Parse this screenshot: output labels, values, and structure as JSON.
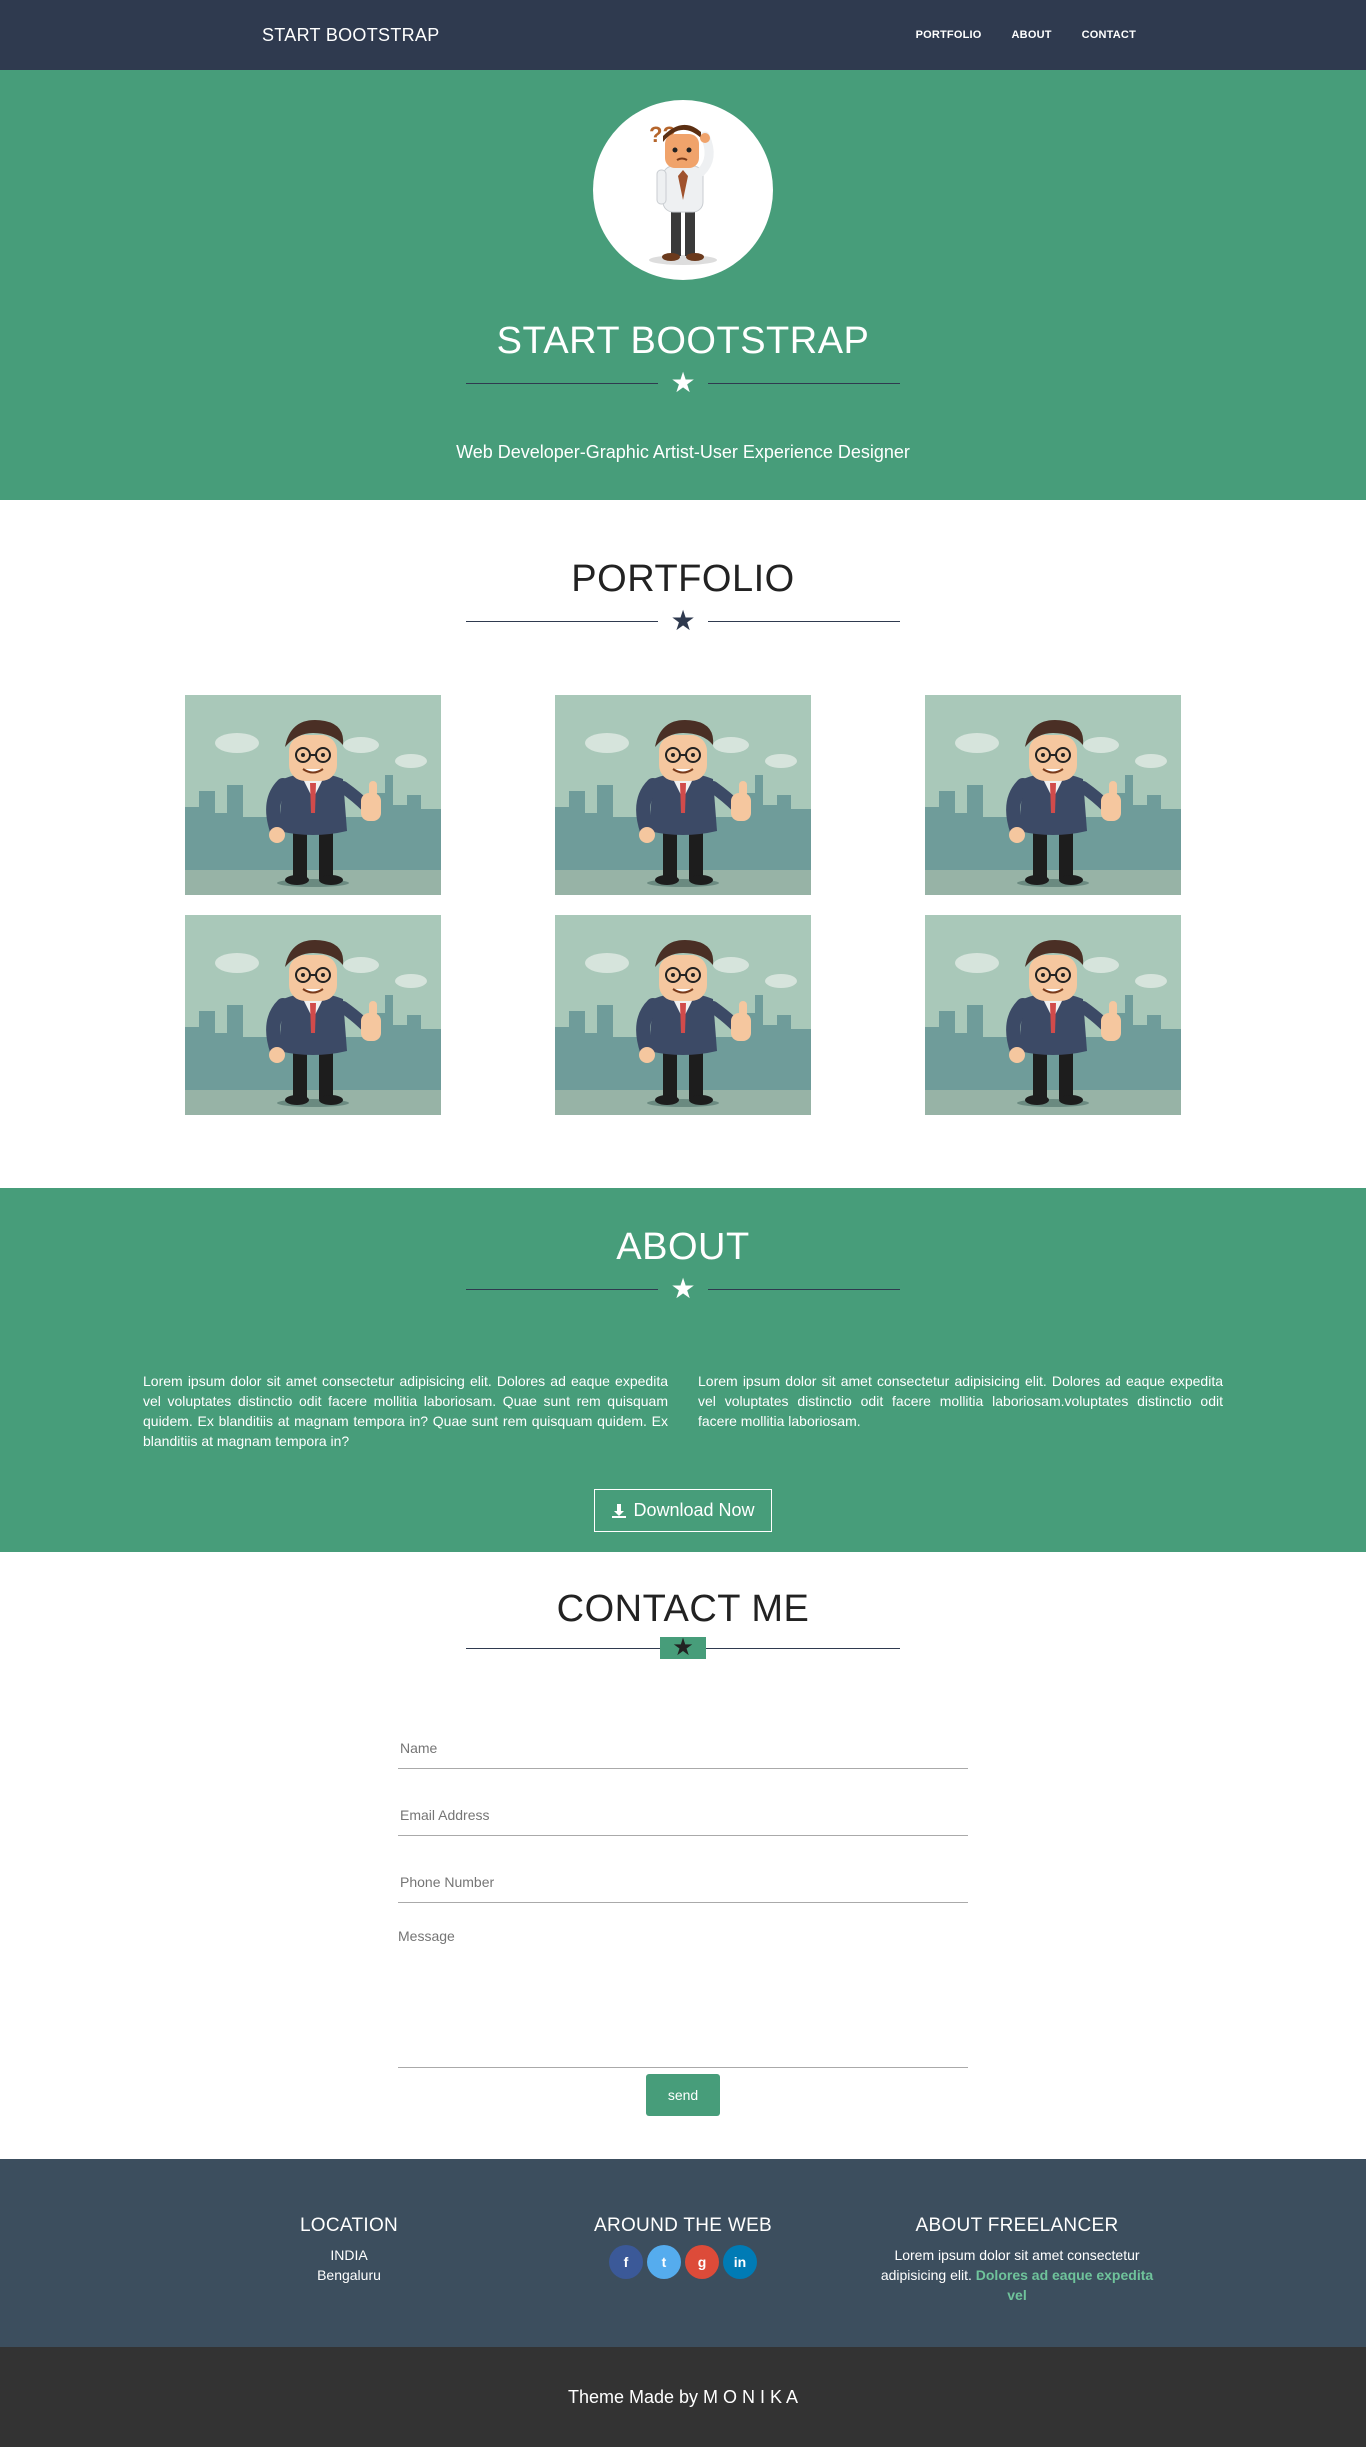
{
  "nav": {
    "brand": "START BOOTSTRAP",
    "links": [
      "PORTFOLIO",
      "ABOUT",
      "CONTACT"
    ]
  },
  "hero": {
    "title": "START BOOTSTRAP",
    "divider_icon": "star-icon",
    "tagline": "Web Developer-Graphic Artist-User Experience Designer"
  },
  "portfolio": {
    "title": "PORTFOLIO",
    "items": [
      {
        "image": "businessman-thumbs-up"
      },
      {
        "image": "businessman-thumbs-up"
      },
      {
        "image": "businessman-thumbs-up"
      },
      {
        "image": "businessman-thumbs-up"
      },
      {
        "image": "businessman-thumbs-up"
      },
      {
        "image": "businessman-thumbs-up"
      }
    ]
  },
  "about": {
    "title": "ABOUT",
    "left_text": "Lorem ipsum dolor sit amet consectetur adipisicing elit. Dolores ad eaque expedita vel voluptates distinctio odit facere mollitia laboriosam. Quae sunt rem quisquam quidem. Ex blanditiis at magnam tempora in? Quae sunt rem quisquam quidem. Ex blanditiis at magnam tempora in?",
    "right_text": "Lorem ipsum dolor sit amet consectetur adipisicing elit. Dolores ad eaque expedita vel voluptates distinctio odit facere mollitia laboriosam.voluptates distinctio odit facere mollitia laboriosam.",
    "download_label": "Download Now",
    "download_icon": "download-icon"
  },
  "contact": {
    "title": "CONTACT ME",
    "name_placeholder": "Name",
    "email_placeholder": "Email Address",
    "phone_placeholder": "Phone Number",
    "message_placeholder": "Message",
    "send_label": "send"
  },
  "footer": {
    "location_title": "LOCATION",
    "location_line1": "INDIA",
    "location_line2": "Bengaluru",
    "web_title": "AROUND THE WEB",
    "socials": [
      {
        "name": "facebook",
        "glyph": "f",
        "color": "#3b5998"
      },
      {
        "name": "twitter",
        "glyph": "t",
        "color": "#55acee"
      },
      {
        "name": "google-plus",
        "glyph": "g",
        "color": "#dd4b39"
      },
      {
        "name": "linkedin",
        "glyph": "in",
        "color": "#007bb5"
      }
    ],
    "freelancer_title": "ABOUT FREELANCER",
    "freelancer_text": "Lorem ipsum dolor sit amet consectetur adipisicing elit.",
    "freelancer_link": "Dolores ad eaque expedita vel"
  },
  "credit": "Theme Made by M O N I K A",
  "colors": {
    "nav": "#2f3a4f",
    "accent": "#479d7a",
    "footer": "#3c4e5e",
    "bottom": "#333333"
  }
}
